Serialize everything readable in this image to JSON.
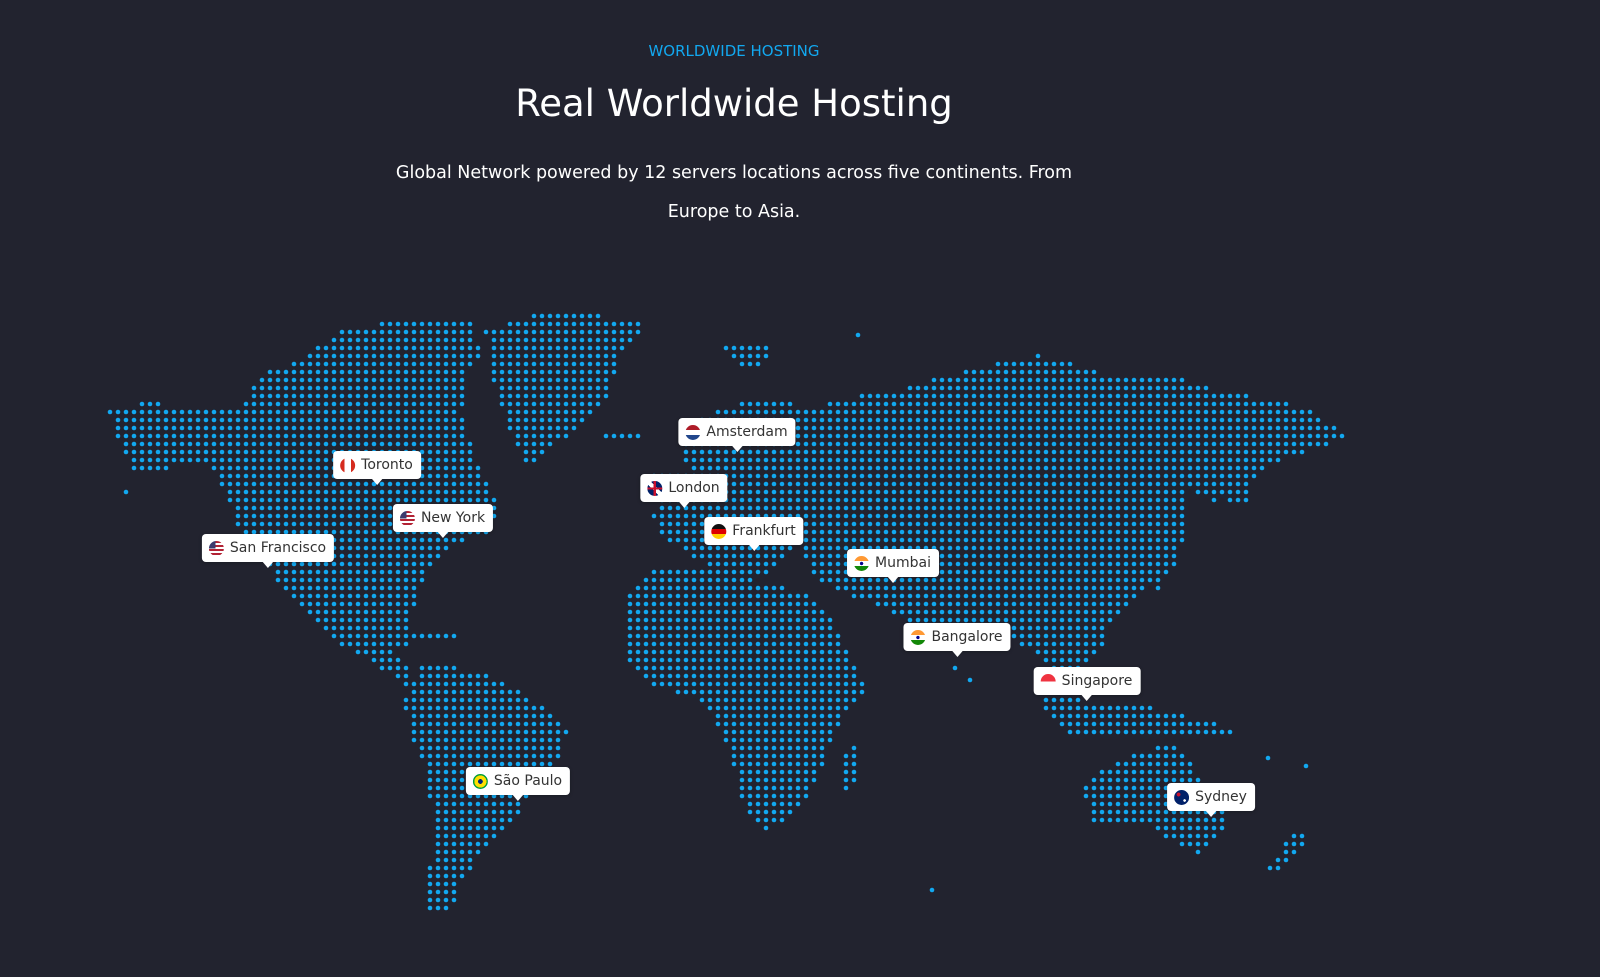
{
  "header": {
    "eyebrow": "WORLDWIDE HOSTING",
    "title": "Real Worldwide Hosting",
    "subtitle": "Global Network powered by 12 servers locations across five continents. From Europe to Asia."
  },
  "colors": {
    "background": "#22232f",
    "accent": "#12a8f0",
    "text": "#ffffff"
  },
  "locations": [
    {
      "id": "amsterdam",
      "label": "Amsterdam",
      "flag": "nl-flag-icon"
    },
    {
      "id": "toronto",
      "label": "Toronto",
      "flag": "ca-flag-icon"
    },
    {
      "id": "london",
      "label": "London",
      "flag": "gb-flag-icon"
    },
    {
      "id": "new-york",
      "label": "New York",
      "flag": "us-flag-icon"
    },
    {
      "id": "frankfurt",
      "label": "Frankfurt",
      "flag": "de-flag-icon"
    },
    {
      "id": "san-francisco",
      "label": "San Francisco",
      "flag": "us-flag-icon"
    },
    {
      "id": "mumbai",
      "label": "Mumbai",
      "flag": "in-flag-icon"
    },
    {
      "id": "bangalore",
      "label": "Bangalore",
      "flag": "in-flag-icon"
    },
    {
      "id": "singapore",
      "label": "Singapore",
      "flag": "sg-flag-icon"
    },
    {
      "id": "sao-paulo",
      "label": "São Paulo",
      "flag": "br-flag-icon"
    },
    {
      "id": "sydney",
      "label": "Sydney",
      "flag": "au-flag-icon"
    }
  ]
}
